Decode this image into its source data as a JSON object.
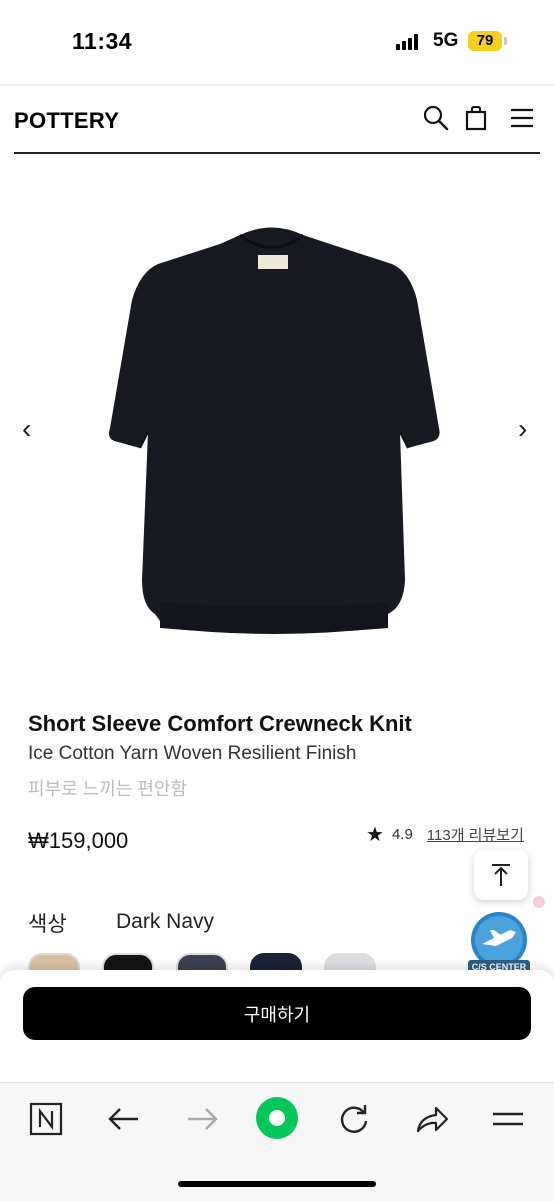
{
  "status": {
    "time": "11:34",
    "network": "5G",
    "battery": "79"
  },
  "header": {
    "logo": "POTTERY",
    "icons": [
      "search-icon",
      "shopping-bag-icon",
      "menu-icon"
    ]
  },
  "carousel": {
    "prev": "‹",
    "next": "›"
  },
  "product": {
    "title": "Short Sleeve Comfort Crewneck Knit",
    "subtitle": "Ice Cotton Yarn Woven Resilient Finish",
    "tagline": "피부로 느끼는 편안함",
    "price": "₩159,000",
    "rating": "4.9",
    "reviews": "113개 리뷰보기"
  },
  "options": {
    "color_label": "색상",
    "selected_color": "Dark Navy",
    "swatches": [
      "#d8c3a0",
      "#141414",
      "#3b4150",
      "#1c2238",
      "#dcdde2"
    ],
    "selected_index": 3
  },
  "cs_badge": "C/S CENTER",
  "buy_button": "구매하기",
  "browser_toolbar": [
    "naver-n-icon",
    "back-icon",
    "forward-icon",
    "green-dot-icon",
    "reload-icon",
    "share-icon",
    "menu-icon"
  ],
  "colors": {
    "accent_green": "#03c75a",
    "battery_yellow": "#f7d21c"
  }
}
